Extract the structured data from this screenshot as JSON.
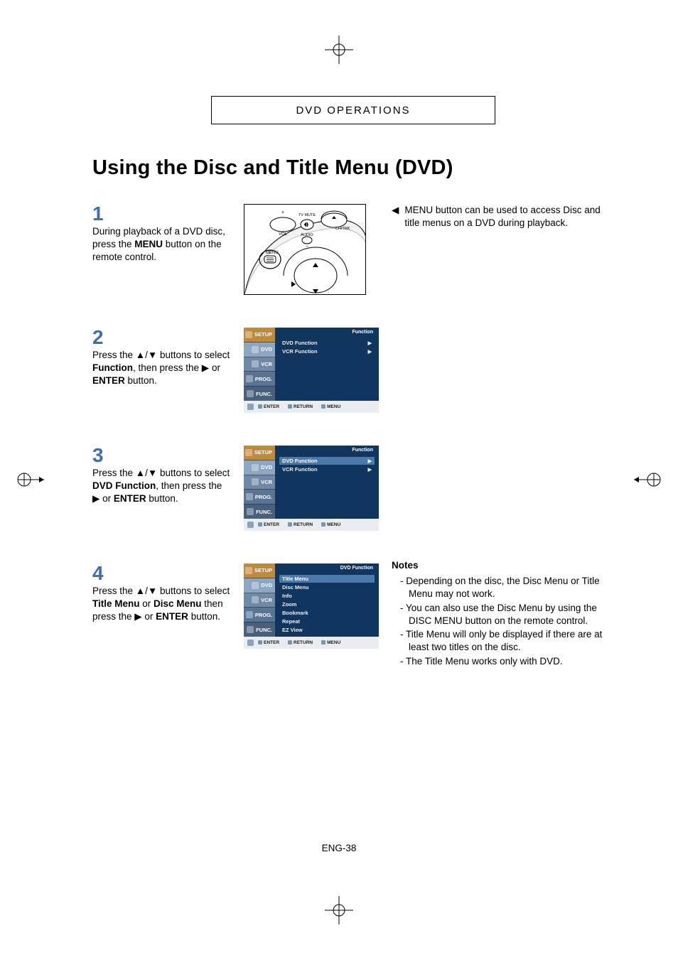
{
  "header": {
    "label": "DVD OPERATIONS"
  },
  "title": "Using the Disc and Title Menu (DVD)",
  "steps": [
    {
      "num": "1",
      "html": "During playback of a DVD disc, press the <b>MENU</b> button on the remote control."
    },
    {
      "num": "2",
      "html": "Press the ▲/▼ buttons to select <b>Function</b>, then press the ▶ or <b>ENTER</b> button."
    },
    {
      "num": "3",
      "html": "Press the ▲/▼ buttons to select <b>DVD Function</b>, then press the ▶ or <b>ENTER</b> button."
    },
    {
      "num": "4",
      "html": "Press the ▲/▼ buttons to select <b>Title Menu</b> or <b>Disc Menu</b> then press the ▶ or <b>ENTER</b> button."
    }
  ],
  "remote_labels": {
    "tv_mute": "TV MUTE",
    "vol": "VOL",
    "chtrk": "CH/TRK",
    "audio": "AUDIO",
    "menu": "MENU",
    "plus": "+",
    "minus": "−"
  },
  "side_note": "MENU button can be used to access Disc and title menus on a DVD during playback.",
  "osd_tabs": [
    "SETUP",
    "DVD",
    "VCR",
    "PROG.",
    "FUNC."
  ],
  "osd_footer": [
    "ENTER",
    "RETURN",
    "MENU"
  ],
  "osd2": {
    "title": "Function",
    "items": [
      {
        "label": "DVD Function",
        "arrow": true,
        "selected": false
      },
      {
        "label": "VCR Function",
        "arrow": true,
        "selected": false
      }
    ]
  },
  "osd3": {
    "title": "Function",
    "items": [
      {
        "label": "DVD Function",
        "arrow": true,
        "selected": true
      },
      {
        "label": "VCR Function",
        "arrow": true,
        "selected": false
      }
    ]
  },
  "osd4": {
    "title": "DVD Function",
    "items": [
      {
        "label": "Title Menu",
        "selected": true
      },
      {
        "label": "Disc Menu",
        "selected": false
      },
      {
        "label": "Info",
        "selected": false
      },
      {
        "label": "Zoom",
        "selected": false
      },
      {
        "label": "Bookmark",
        "selected": false
      },
      {
        "label": "Repeat",
        "selected": false
      },
      {
        "label": "EZ View",
        "selected": false
      }
    ]
  },
  "notes": {
    "heading": "Notes",
    "items": [
      "Depending on the disc, the Disc Menu or Title Menu may not work.",
      "You can also use the Disc Menu by using the DISC MENU button on the remote control.",
      "Title Menu will only be displayed if there are at least two titles on the disc.",
      "The Title Menu works only with DVD."
    ]
  },
  "page_footer": "ENG-38"
}
